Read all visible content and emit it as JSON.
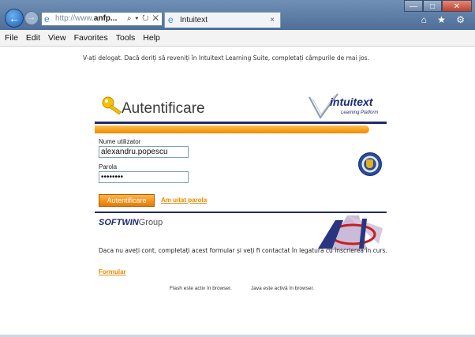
{
  "browser": {
    "address": {
      "prefix": "http://www.",
      "domain": "anfp...",
      "controls": "⌕ ▾ ↻ ✕"
    },
    "tab": {
      "title": "Intuitext",
      "close": "×"
    },
    "window_controls": {
      "minimize": "—",
      "maximize": "□",
      "close": "✕"
    },
    "right_icons": "⌂ ★ ⚙"
  },
  "menu": [
    "File",
    "Edit",
    "View",
    "Favorites",
    "Tools",
    "Help"
  ],
  "page": {
    "notice": "V-ați delogat. Dacă doriți să reveniți în Intuitext Learning Suite, completați câmpurile de mai jos.",
    "title": "Autentificare",
    "logo": {
      "name": "intuitext",
      "sub": "Learning Platform"
    },
    "username_label": "Nume utilizator",
    "username_value": "alexandru.popescu",
    "password_label": "Parola",
    "password_value": "••••••••",
    "login_button": "Autentificare",
    "forgot_link": "Am uitat parola",
    "softwin": {
      "brand": "SOFTWIN",
      "group": "Group"
    },
    "register_text": "Daca nu aveți cont, completați acest formular și veți fi contactat în legatura cu înscrierea în curs.",
    "form_link": "Formular",
    "flash_status": "Flash este activ în browser.",
    "java_status": "Java este activă în browser."
  },
  "colors": {
    "accent": "#f08a00",
    "navy": "#1d2a6e"
  }
}
